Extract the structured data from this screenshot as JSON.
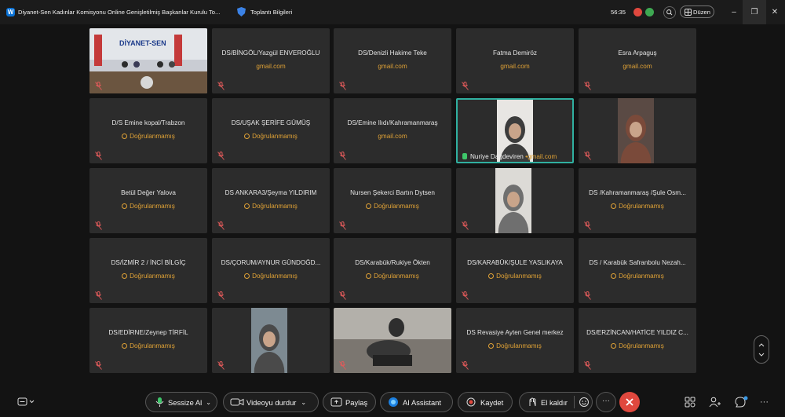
{
  "window": {
    "title": "Diyanet-Sen Kadınlar Komisyonu Online Genişletilmiş Başkanlar Kurulu To...",
    "info_label": "Toplantı Bilgileri",
    "timer": "56:35",
    "layout_label": "Düzen",
    "minimize": "–",
    "restore": "❐",
    "close": "✕"
  },
  "tiles": [
    {
      "id": "t1",
      "name": "",
      "sub": "",
      "kind": "room"
    },
    {
      "id": "t2",
      "name": "DS/BİNGÖL/Yazgül ENVEROĞLU",
      "sub": "gmail.com",
      "kind": "email"
    },
    {
      "id": "t3",
      "name": "DS/Denizli Hakime Teke",
      "sub": "gmail.com",
      "kind": "email"
    },
    {
      "id": "t4",
      "name": "Fatma Demiröz",
      "sub": "gmail.com",
      "kind": "email"
    },
    {
      "id": "t5",
      "name": "Esra Arpaguş",
      "sub": "gmail.com",
      "kind": "email"
    },
    {
      "id": "t6",
      "name": "D/S Emine kopal/Trabzon",
      "sub": "Doğrulanmamış",
      "kind": "unverified"
    },
    {
      "id": "t7",
      "name": "DS/UŞAK ŞERİFE GÜMÜŞ",
      "sub": "Doğrulanmamış",
      "kind": "unverified"
    },
    {
      "id": "t8",
      "name": "DS/Emine Ilıdı/Kahramanmaraş",
      "sub": "gmail.com",
      "kind": "email"
    },
    {
      "id": "t9",
      "name": "Nuriye Dağdeviren",
      "sub": "gmail.com",
      "kind": "video-active"
    },
    {
      "id": "t10",
      "name": "",
      "sub": "",
      "kind": "video"
    },
    {
      "id": "t11",
      "name": "Betül Değer Yalova",
      "sub": "Doğrulanmamış",
      "kind": "unverified"
    },
    {
      "id": "t12",
      "name": "DS ANKARA3/Şeyma YILDIRIM",
      "sub": "Doğrulanmamış",
      "kind": "unverified"
    },
    {
      "id": "t13",
      "name": "Nursen Şekerci Bartın Dytsen",
      "sub": "Doğrulanmamış",
      "kind": "unverified"
    },
    {
      "id": "t14",
      "name": "",
      "sub": "",
      "kind": "video"
    },
    {
      "id": "t15",
      "name": "DS /Kahramanmaraş /Şule Osm...",
      "sub": "Doğrulanmamış",
      "kind": "unverified"
    },
    {
      "id": "t16",
      "name": "DS/İZMİR 2 / İNCİ BİLGİÇ",
      "sub": "Doğrulanmamış",
      "kind": "unverified"
    },
    {
      "id": "t17",
      "name": "DS/ÇORUM/AYNUR GÜNDOĞD...",
      "sub": "Doğrulanmamış",
      "kind": "unverified"
    },
    {
      "id": "t18",
      "name": "DS/Karabük/Rukiye Ökten",
      "sub": "Doğrulanmamış",
      "kind": "unverified"
    },
    {
      "id": "t19",
      "name": "DS/KARABÜK/ŞULE YASLIKAYA",
      "sub": "Doğrulanmamış",
      "kind": "unverified"
    },
    {
      "id": "t20",
      "name": "DS / Karabük Safranbolu Nezah...",
      "sub": "Doğrulanmamış",
      "kind": "unverified"
    },
    {
      "id": "t21",
      "name": "DS/EDİRNE/Zeynep TİRFİL",
      "sub": "Doğrulanmamış",
      "kind": "unverified"
    },
    {
      "id": "t22",
      "name": "",
      "sub": "",
      "kind": "video"
    },
    {
      "id": "t23",
      "name": "",
      "sub": "",
      "kind": "video-wide"
    },
    {
      "id": "t24",
      "name": "DS Revasiye Ayten Genel merkez",
      "sub": "Doğrulanmamış",
      "kind": "unverified"
    },
    {
      "id": "t25",
      "name": "DS/ERZİNCAN/HATİCE YILDIZ C...",
      "sub": "Doğrulanmamış",
      "kind": "unverified"
    }
  ],
  "room_sign": "DİYANET-SEN",
  "toolbar": {
    "mute": "Sessize Al",
    "video": "Videoyu durdur",
    "share": "Paylaş",
    "ai": "AI Assistant",
    "record": "Kaydet",
    "raise": "El kaldır",
    "more": "···"
  },
  "colors": {
    "accent": "#30b0a0",
    "warning": "#e0a236",
    "danger": "#e0483e",
    "tile": "#2c2c2c"
  }
}
